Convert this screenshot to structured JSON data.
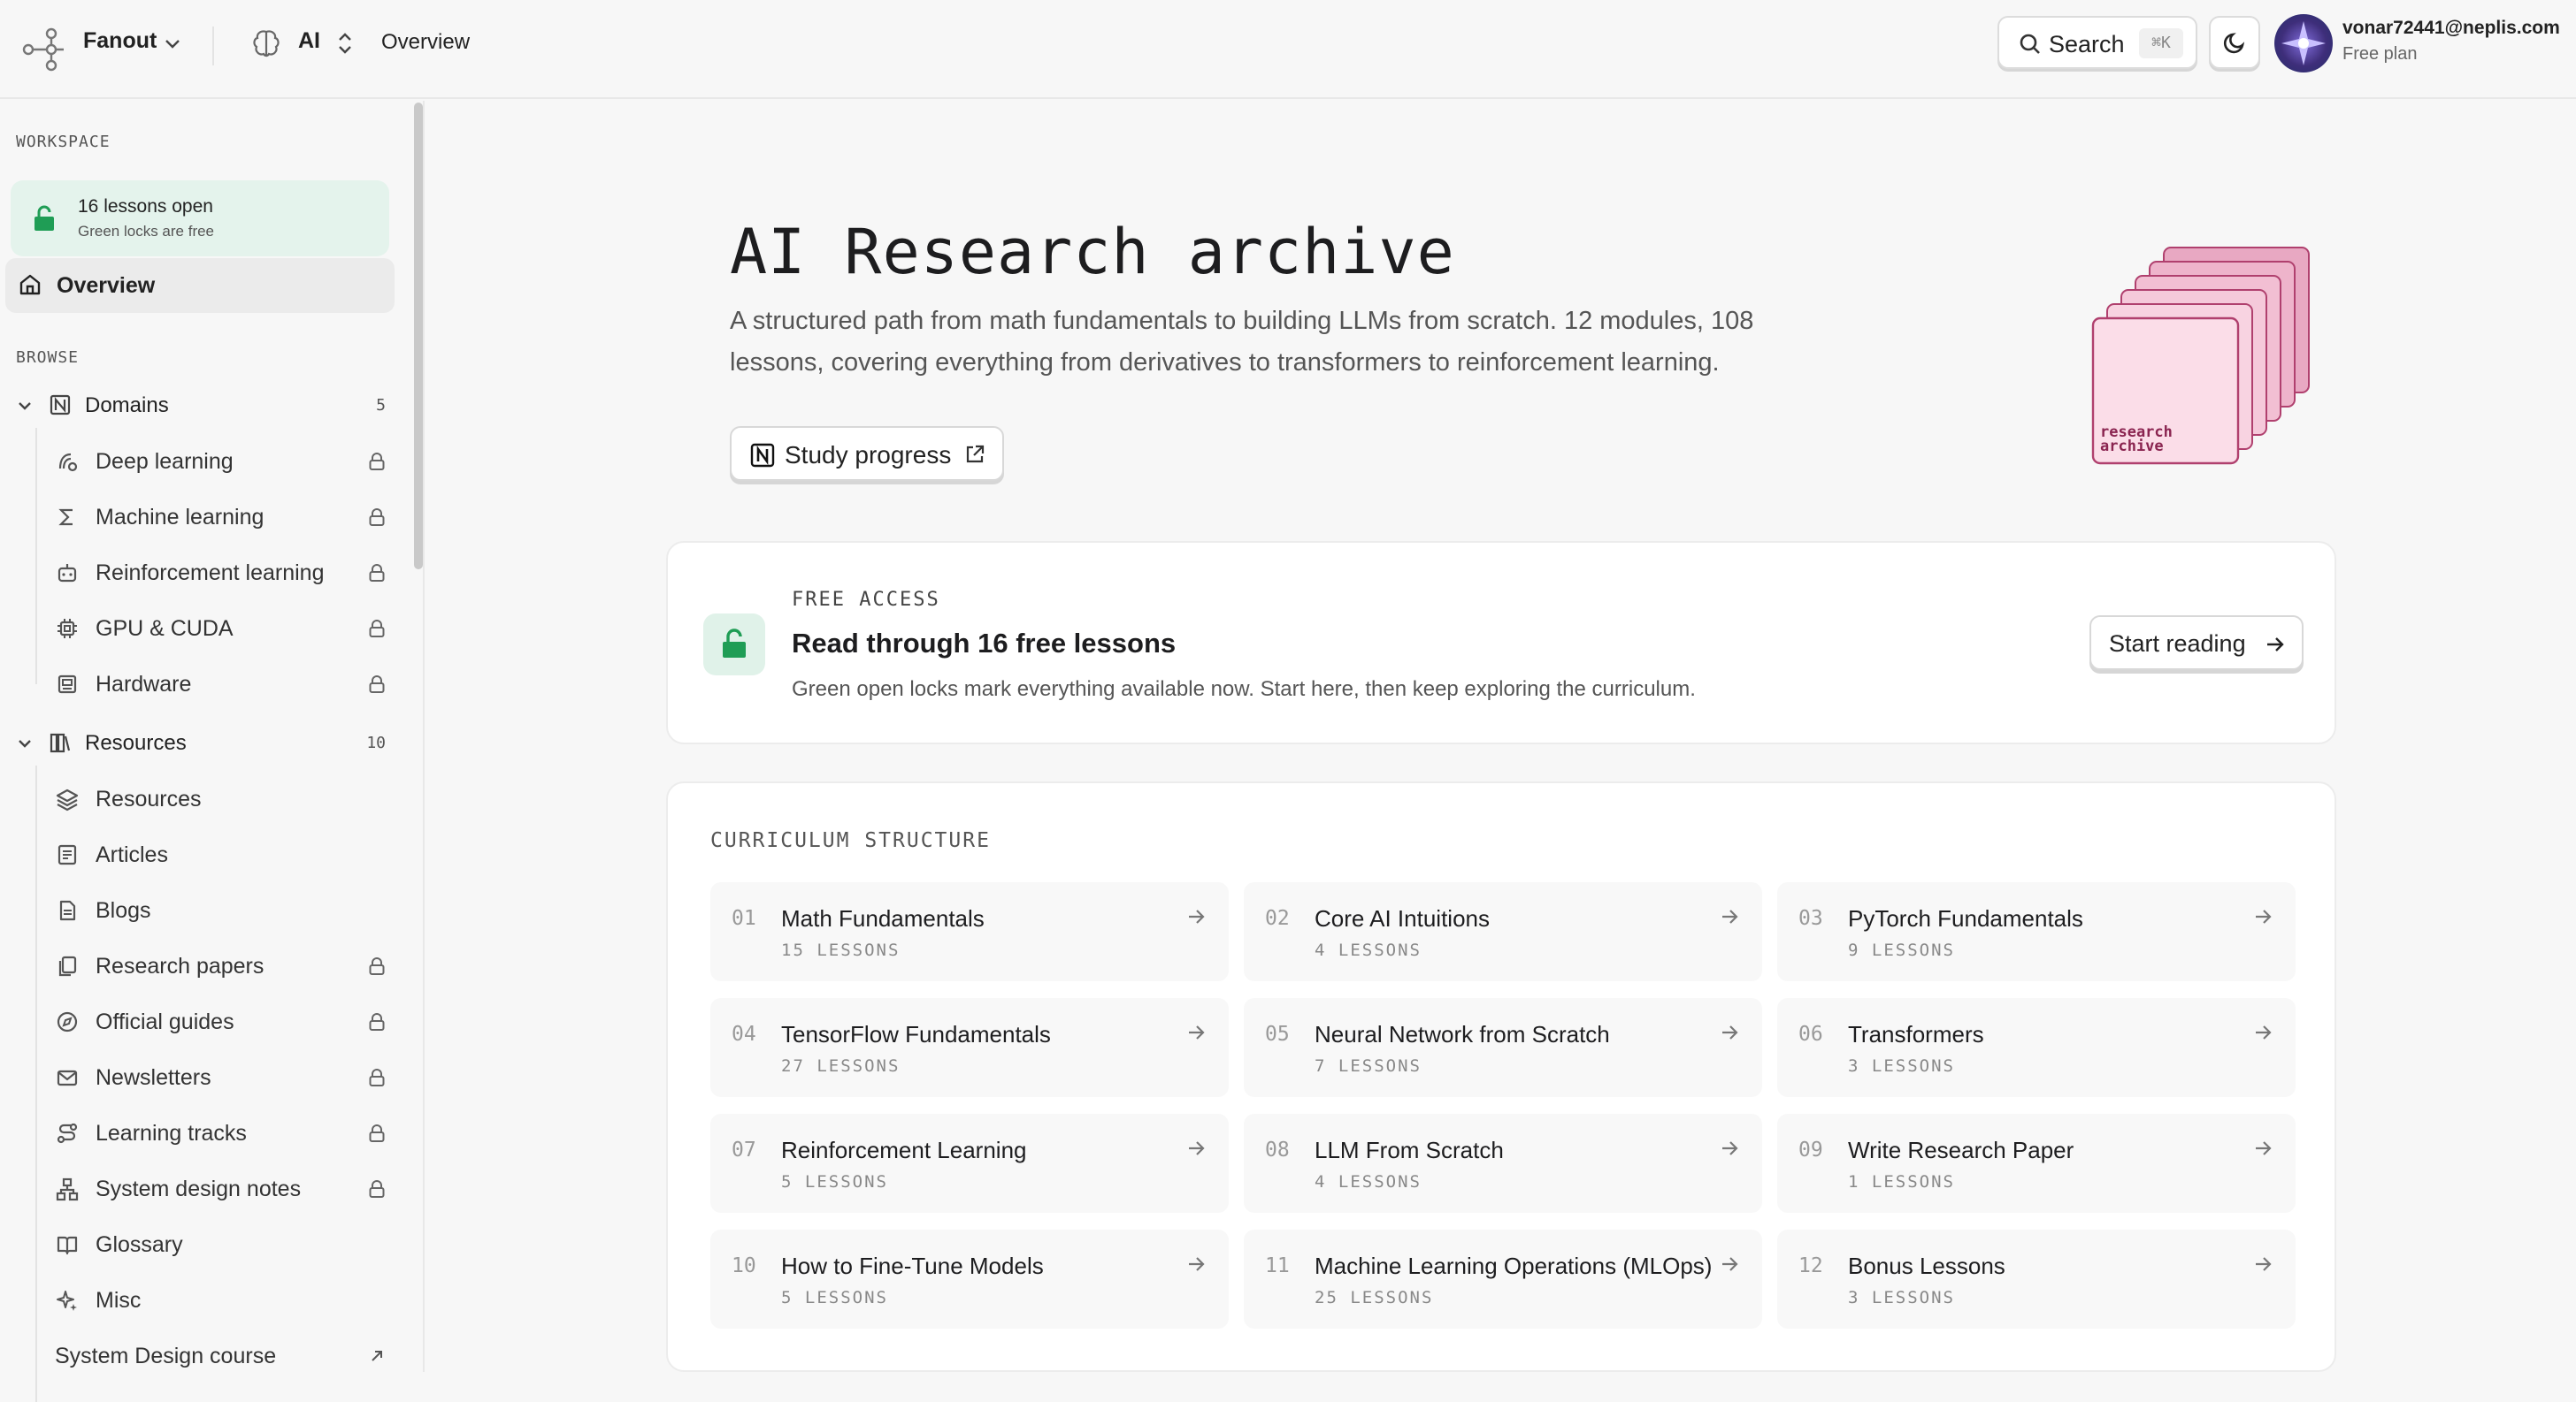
{
  "topbar": {
    "brand": "Fanout",
    "workspace": "AI",
    "crumb": "Overview",
    "search_label": "Search",
    "search_shortcut": "⌘K",
    "user_email": "vonar72441@neplis.com",
    "user_plan": "Free plan"
  },
  "sidebar": {
    "workspace_heading": "WORKSPACE",
    "lessons_open_title": "16 lessons open",
    "lessons_open_sub": "Green locks are free",
    "overview": "Overview",
    "browse_heading": "BROWSE",
    "domains": {
      "label": "Domains",
      "count": "5",
      "items": [
        {
          "label": "Deep learning",
          "icon": "deep-learning-icon",
          "locked": true
        },
        {
          "label": "Machine learning",
          "icon": "sigma-icon",
          "locked": true
        },
        {
          "label": "Reinforcement learning",
          "icon": "robot-icon",
          "locked": true
        },
        {
          "label": "GPU & CUDA",
          "icon": "chip-icon",
          "locked": true
        },
        {
          "label": "Hardware",
          "icon": "hardware-icon",
          "locked": true
        }
      ]
    },
    "resources": {
      "label": "Resources",
      "count": "10",
      "items": [
        {
          "label": "Resources",
          "icon": "layers-icon",
          "locked": false
        },
        {
          "label": "Articles",
          "icon": "article-icon",
          "locked": false
        },
        {
          "label": "Blogs",
          "icon": "blog-icon",
          "locked": false
        },
        {
          "label": "Research papers",
          "icon": "papers-icon",
          "locked": true
        },
        {
          "label": "Official guides",
          "icon": "compass-icon",
          "locked": true
        },
        {
          "label": "Newsletters",
          "icon": "mail-icon",
          "locked": true
        },
        {
          "label": "Learning tracks",
          "icon": "route-icon",
          "locked": true
        },
        {
          "label": "System design notes",
          "icon": "network-icon",
          "locked": true
        },
        {
          "label": "Glossary",
          "icon": "book-icon",
          "locked": false
        },
        {
          "label": "Misc",
          "icon": "sparkles-icon",
          "locked": false
        }
      ]
    },
    "system_design": "System Design course"
  },
  "hero": {
    "title": "AI Research archive",
    "description": "A structured path from math fundamentals to building LLMs from scratch. 12 modules, 108 lessons, covering everything from derivatives to transformers to reinforcement learning.",
    "study_button": "Study progress",
    "art_text_1": "research",
    "art_text_2": "archive"
  },
  "free": {
    "eyebrow": "FREE ACCESS",
    "title": "Read through 16 free lessons",
    "description": "Green open locks mark everything available now. Start here, then keep exploring the curriculum.",
    "button": "Start reading"
  },
  "curriculum": {
    "eyebrow": "CURRICULUM STRUCTURE",
    "modules": [
      {
        "num": "01",
        "name": "Math Fundamentals",
        "lessons": "15 LESSONS"
      },
      {
        "num": "02",
        "name": "Core AI Intuitions",
        "lessons": "4 LESSONS"
      },
      {
        "num": "03",
        "name": "PyTorch Fundamentals",
        "lessons": "9 LESSONS"
      },
      {
        "num": "04",
        "name": "TensorFlow Fundamentals",
        "lessons": "27 LESSONS"
      },
      {
        "num": "05",
        "name": "Neural Network from Scratch",
        "lessons": "7 LESSONS"
      },
      {
        "num": "06",
        "name": "Transformers",
        "lessons": "3 LESSONS"
      },
      {
        "num": "07",
        "name": "Reinforcement Learning",
        "lessons": "5 LESSONS"
      },
      {
        "num": "08",
        "name": "LLM From Scratch",
        "lessons": "4 LESSONS"
      },
      {
        "num": "09",
        "name": "Write Research Paper",
        "lessons": "1 LESSONS"
      },
      {
        "num": "10",
        "name": "How to Fine-Tune Models",
        "lessons": "5 LESSONS"
      },
      {
        "num": "11",
        "name": "Machine Learning Operations (MLOps)",
        "lessons": "25 LESSONS"
      },
      {
        "num": "12",
        "name": "Bonus Lessons",
        "lessons": "3 LESSONS"
      }
    ]
  },
  "colors": {
    "accent_green": "#1f9d55",
    "free_bg": "#e4f3ec",
    "archive_pink": "#f7c9d9",
    "archive_edge": "#b0406e"
  }
}
